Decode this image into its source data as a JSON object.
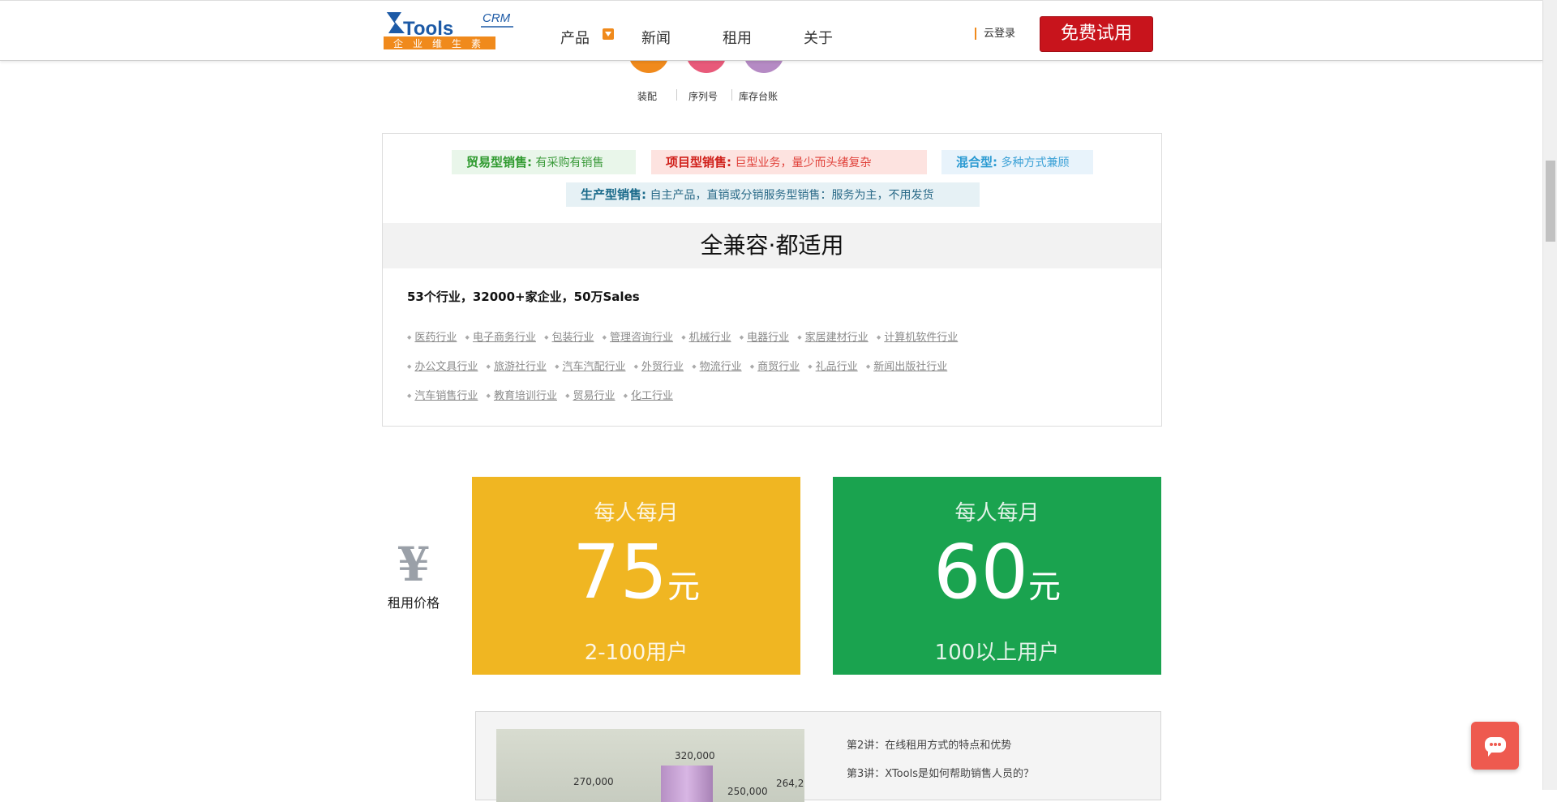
{
  "header": {
    "logo": {
      "text": "Tools",
      "crm": "CRM",
      "tagline": [
        "企",
        "业",
        "维",
        "生",
        "素"
      ]
    },
    "nav": [
      "产品",
      "新闻",
      "租用",
      "关于"
    ],
    "login": "云登录",
    "trial_button": "免费试用"
  },
  "modules": [
    {
      "label": "装配",
      "color": "#f08a1c"
    },
    {
      "label": "序列号",
      "color": "#e85a7a"
    },
    {
      "label": "库存台账",
      "color": "#b58ac4"
    }
  ],
  "compat": {
    "tags": [
      {
        "title": "贸易型销售:",
        "desc": "有采购有销售",
        "bg": "#e9f6ea",
        "title_color": "#2f9a2f",
        "desc_color": "#3a9a3a"
      },
      {
        "title": "项目型销售:",
        "desc": "巨型业务，量少而头绪复杂",
        "bg": "#fde3e0",
        "title_color": "#d0201a",
        "desc_color": "#e0413a"
      },
      {
        "title": "混合型:",
        "desc": "多种方式兼顾",
        "bg": "#e8f3fb",
        "title_color": "#2a9ad2",
        "desc_color": "#3aa0d6"
      },
      {
        "title": "生产型销售:",
        "desc": "自主产品，直销或分销服务型销售：服务为主，不用发货",
        "bg": "#e6f1f5",
        "title_color": "#1a6a8a",
        "desc_color": "#2a6a88"
      }
    ],
    "title": "全兼容·都适用",
    "subtitle": "53个行业，32000+家企业，50万Sales",
    "industries": [
      [
        "医药行业",
        "电子商务行业",
        "包装行业",
        "管理咨询行业",
        "机械行业",
        "电器行业",
        "家居建材行业",
        "计算机软件行业"
      ],
      [
        "办公文具行业",
        "旅游社行业",
        "汽车汽配行业",
        "外贸行业",
        "物流行业",
        "商贸行业",
        "礼品行业",
        "新闻出版社行业"
      ],
      [
        "汽车销售行业",
        "教育培训行业",
        "贸易行业",
        "化工行业"
      ]
    ]
  },
  "pricing": {
    "label": "租用价格",
    "icon": "¥",
    "cards": [
      {
        "per": "每人每月",
        "amount": "75",
        "unit": "元",
        "users": "2-100用户",
        "color": "#f0b622"
      },
      {
        "per": "每人每月",
        "amount": "60",
        "unit": "元",
        "users": "100以上用户",
        "color": "#1aa34f"
      }
    ]
  },
  "bottom": {
    "chart_labels": [
      "270,000",
      "320,000",
      "250,000",
      "264,2"
    ],
    "lectures": [
      "第2讲：在线租用方式的特点和优势",
      "第3讲：XTools是如何帮助销售人员的？"
    ]
  }
}
